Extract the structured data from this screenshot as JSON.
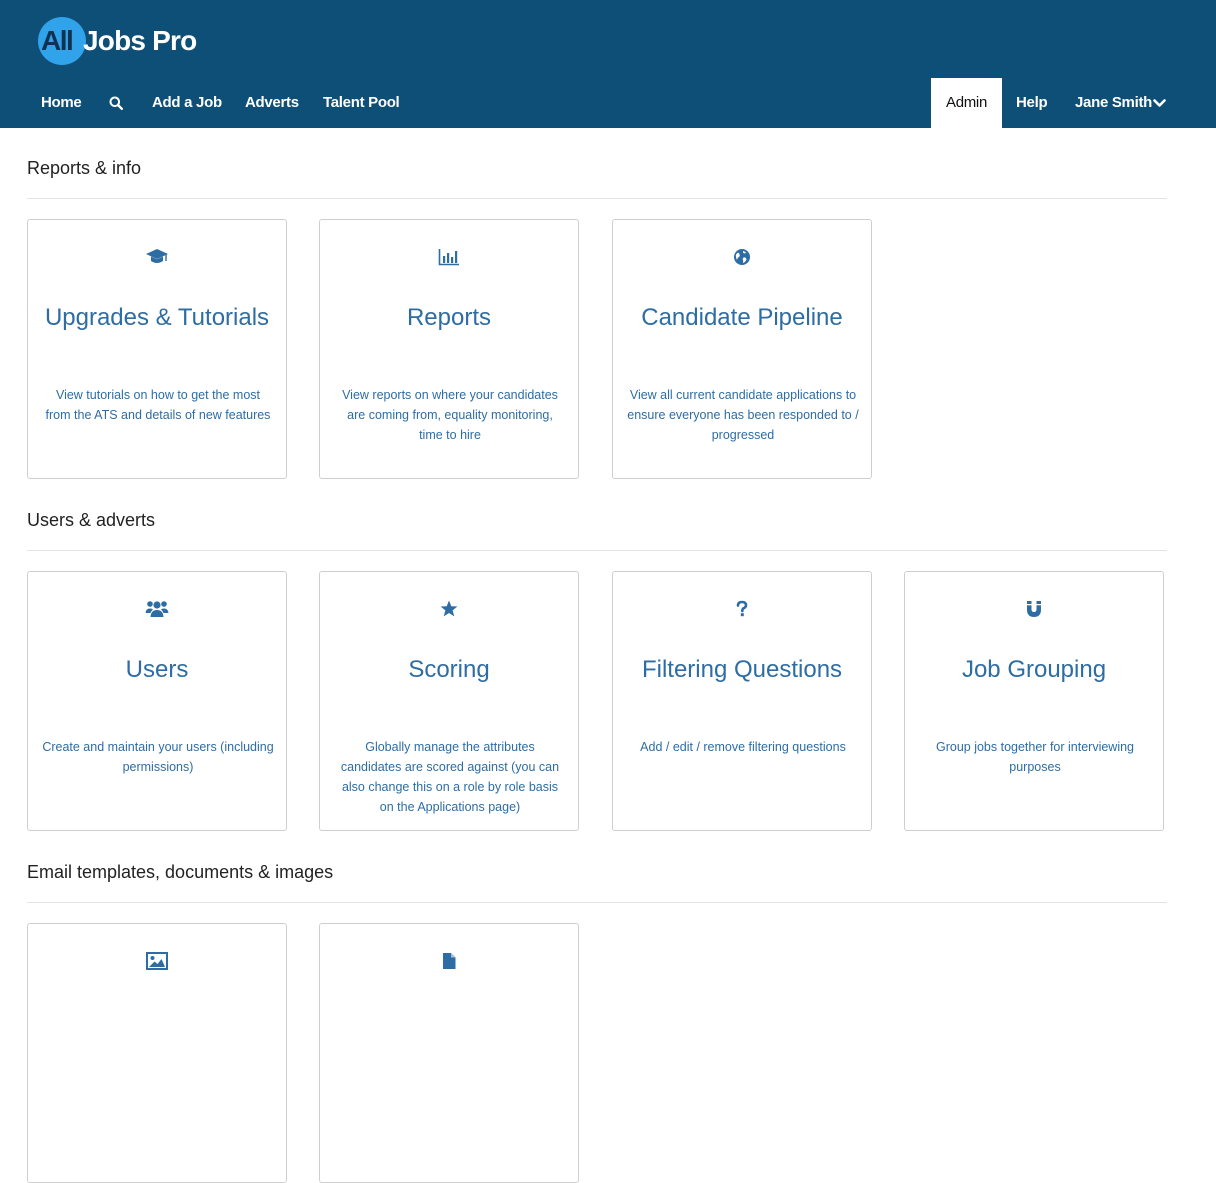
{
  "brand": {
    "logo_all": "All",
    "logo_rest": "Jobs Pro"
  },
  "nav": {
    "home": "Home",
    "add_job": "Add a Job",
    "adverts": "Adverts",
    "talent_pool": "Talent Pool",
    "admin": "Admin",
    "help": "Help",
    "user": "Jane Smith"
  },
  "sections": [
    {
      "title": "Reports & info",
      "cards": [
        {
          "icon": "graduation-cap-icon",
          "title": "Upgrades & Tutorials",
          "desc": "View tutorials on how to get the most from the ATS and details of new features"
        },
        {
          "icon": "bar-chart-icon",
          "title": "Reports",
          "desc": "View reports on where your candidates are coming from, equality monitoring, time to hire"
        },
        {
          "icon": "globe-icon",
          "title": "Candidate Pipeline",
          "desc": "View all current candidate applications to ensure everyone has been responded to / progressed"
        }
      ]
    },
    {
      "title": "Users & adverts",
      "cards": [
        {
          "icon": "users-icon",
          "title": "Users",
          "desc": "Create and maintain your users (including permissions)"
        },
        {
          "icon": "star-icon",
          "title": "Scoring",
          "desc": "Globally manage the attributes candidates are scored against (you can also change this on a role by role basis on the Applications page)"
        },
        {
          "icon": "question-icon",
          "title": "Filtering Questions",
          "desc": "Add / edit / remove filtering questions"
        },
        {
          "icon": "magnet-icon",
          "title": "Job Grouping",
          "desc": "Group jobs together for interviewing purposes"
        }
      ]
    },
    {
      "title": "Email templates, documents & images",
      "cards": [
        {
          "icon": "image-icon"
        },
        {
          "icon": "file-icon"
        }
      ]
    }
  ],
  "colors": {
    "header_bg": "#0e4f77",
    "logo_circle": "#31a3eb",
    "accent": "#2e6da4"
  }
}
